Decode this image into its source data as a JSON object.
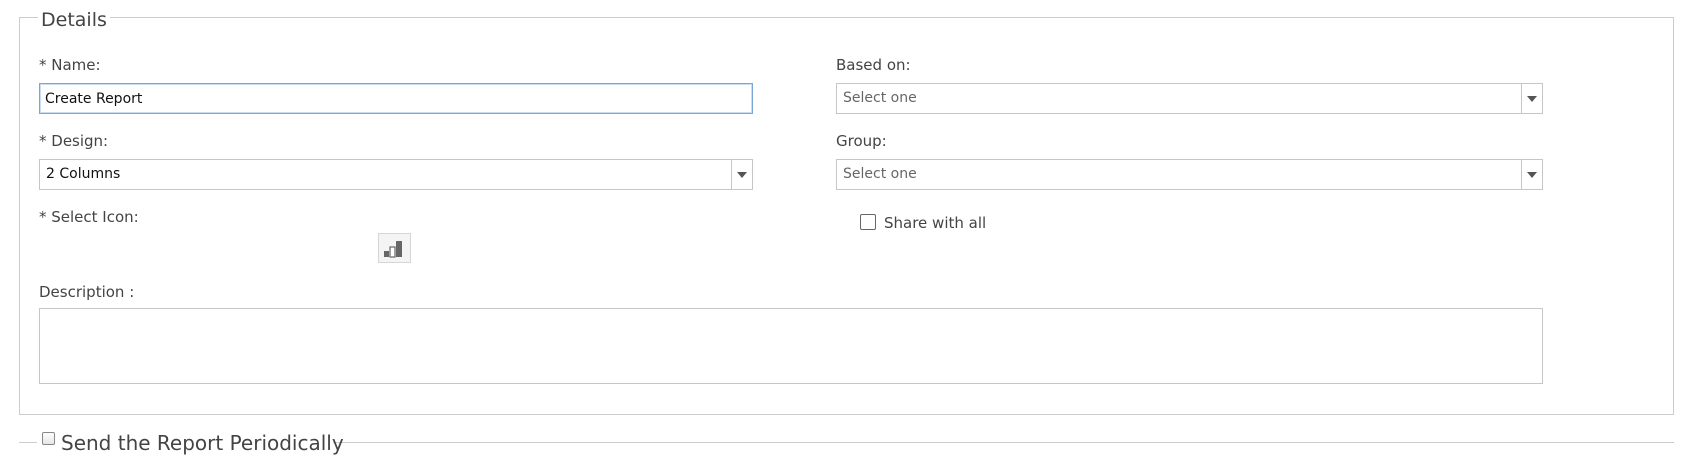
{
  "details": {
    "legend": "Details",
    "name_label": "* Name:",
    "name_value": "Create Report",
    "design_label": "* Design:",
    "design_value": "2 Columns",
    "select_icon_label": "* Select Icon:",
    "selected_icon": "bar-chart-icon",
    "description_label": "Description :",
    "description_value": "",
    "based_on_label": "Based on:",
    "based_on_placeholder": "Select one",
    "group_label": "Group:",
    "group_placeholder": "Select one",
    "share_label": "Share with all",
    "share_checked": false
  },
  "periodic": {
    "label": "Send the Report Periodically",
    "checked": false
  },
  "colors": {
    "focus_border": "#7aa7d8",
    "border": "#c6c6c6",
    "icon_bar": "#666666"
  }
}
